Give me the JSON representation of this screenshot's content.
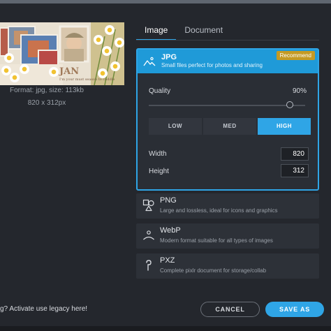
{
  "preview": {
    "format_line": "Format: jpg, size: 113kb",
    "dimensions_line": "820 x 312px",
    "caption": "JAN",
    "note": "I'm your must season to cuddle"
  },
  "tabs": [
    {
      "label": "Image",
      "active": true
    },
    {
      "label": "Document",
      "active": false
    }
  ],
  "jpg": {
    "title": "JPG",
    "description": "Small files perfect for photos and sharing",
    "badge": "Recommend",
    "icon": "landscape-icon",
    "quality_label": "Quality",
    "quality_value": "90%",
    "quality_fraction": 0.9,
    "levels": [
      "LOW",
      "MED",
      "HIGH"
    ],
    "selected_level": "HIGH",
    "width_label": "Width",
    "width_value": "820",
    "height_label": "Height",
    "height_value": "312"
  },
  "formats": [
    {
      "title": "PNG",
      "description": "Large and lossless, ideal for icons and graphics",
      "icon": "shapes-icon"
    },
    {
      "title": "WebP",
      "description": "Modern format suitable for all types of images",
      "icon": "person-icon"
    },
    {
      "title": "PXZ",
      "description": "Complete pixlr document for storage/collab",
      "icon": "pixlr-logo-icon"
    }
  ],
  "footer": {
    "legacy_text": "g? Activate use legacy here!",
    "cancel_label": "CANCEL",
    "save_label": "SAVE AS"
  },
  "colors": {
    "accent": "#2fa5e6",
    "badge": "#c49a23",
    "background": "#24272d"
  }
}
